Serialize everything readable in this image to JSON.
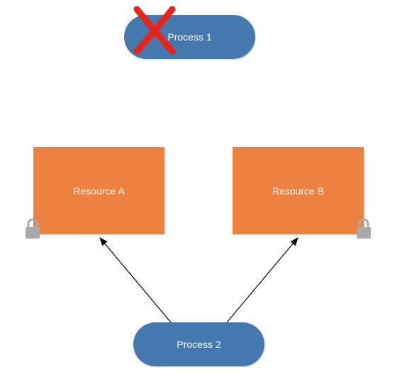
{
  "process1": {
    "label": "Process 1"
  },
  "process2": {
    "label": "Process 2"
  },
  "resourceA": {
    "label": "Resource A"
  },
  "resourceB": {
    "label": "Resource B"
  },
  "colors": {
    "process_fill": "#4678b0",
    "resource_fill": "#ed8140",
    "x_stroke": "#e82319",
    "lock_fill": "#a9a9aa",
    "arrow_stroke": "#000000"
  }
}
